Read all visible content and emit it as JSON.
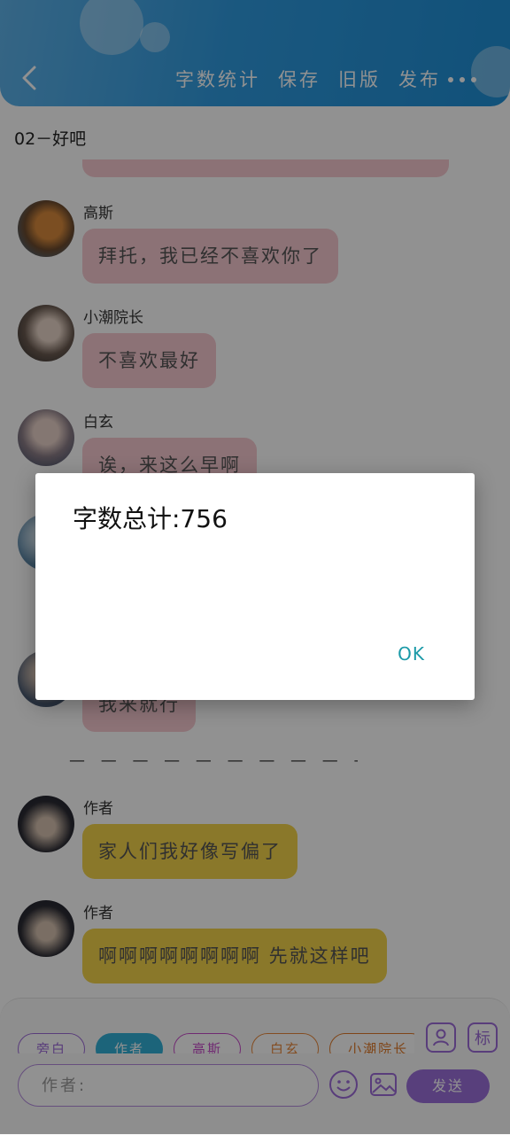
{
  "header": {
    "toolbar": [
      "字数统计",
      "保存",
      "旧版",
      "发布"
    ]
  },
  "chapter": {
    "title": "02－好吧"
  },
  "messages": [
    {
      "name": "高斯",
      "text": "拜托，我已经不喜欢你了",
      "style": "pink"
    },
    {
      "name": "小潮院长",
      "text": "不喜欢最好",
      "style": "pink"
    },
    {
      "name": "白玄",
      "text": "诶，来这么早啊",
      "style": "pink"
    },
    {
      "name": "",
      "text": "",
      "style": "pink"
    },
    {
      "name": "",
      "text": "我来就行",
      "style": "pink"
    },
    {
      "name": "作者",
      "text": "家人们我好像写偏了",
      "style": "yellow"
    },
    {
      "name": "作者",
      "text": "啊啊啊啊啊啊啊啊 先就这样吧",
      "style": "yellow"
    }
  ],
  "divider": "— — — — — — — — — — — — — —",
  "dialog": {
    "message": "字数总计:756",
    "ok_label": "OK"
  },
  "composer": {
    "chips": [
      {
        "label": "旁白",
        "color": "purple",
        "selected": false
      },
      {
        "label": "作者",
        "color": "blue",
        "selected": true
      },
      {
        "label": "高斯",
        "color": "magenta",
        "selected": false
      },
      {
        "label": "白玄",
        "color": "orange",
        "selected": false
      },
      {
        "label": "小潮院长",
        "color": "orange2",
        "selected": false
      },
      {
        "label": "",
        "color": "pink",
        "selected": false
      }
    ],
    "role_icon_label": "标",
    "input_placeholder": "作者:",
    "send_label": "发送"
  },
  "colors": {
    "header": "#2f9be0",
    "pink_bubble": "#f6c9d0",
    "yellow_bubble": "#f3d34a",
    "accent_purple": "#9b6fdb",
    "ok_text": "#1b9aa8"
  }
}
